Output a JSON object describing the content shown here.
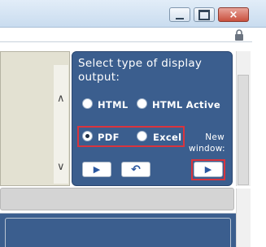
{
  "window": {
    "minimize_icon": "minimize-icon",
    "maximize_icon": "maximize-icon",
    "close_icon": "close-icon",
    "close_glyph": "×"
  },
  "address_bar": {
    "lock_icon": "lock-icon"
  },
  "options_panel": {
    "title": "Select type of display output:",
    "radios": [
      {
        "label": "HTML",
        "checked": false
      },
      {
        "label": "HTML Active",
        "checked": false
      },
      {
        "label": "PDF",
        "checked": true
      },
      {
        "label": "Excel",
        "checked": false
      }
    ],
    "new_window_label": "New window:",
    "buttons": {
      "run_glyph": "▶",
      "back_glyph": "↶",
      "new_window_glyph": "▶"
    }
  },
  "scroll": {
    "up_glyph": "∧",
    "down_glyph": "∨"
  },
  "colors": {
    "panel_blue": "#3b5e8e",
    "highlight_red": "#d9343d",
    "beige": "#e3e1d2"
  }
}
